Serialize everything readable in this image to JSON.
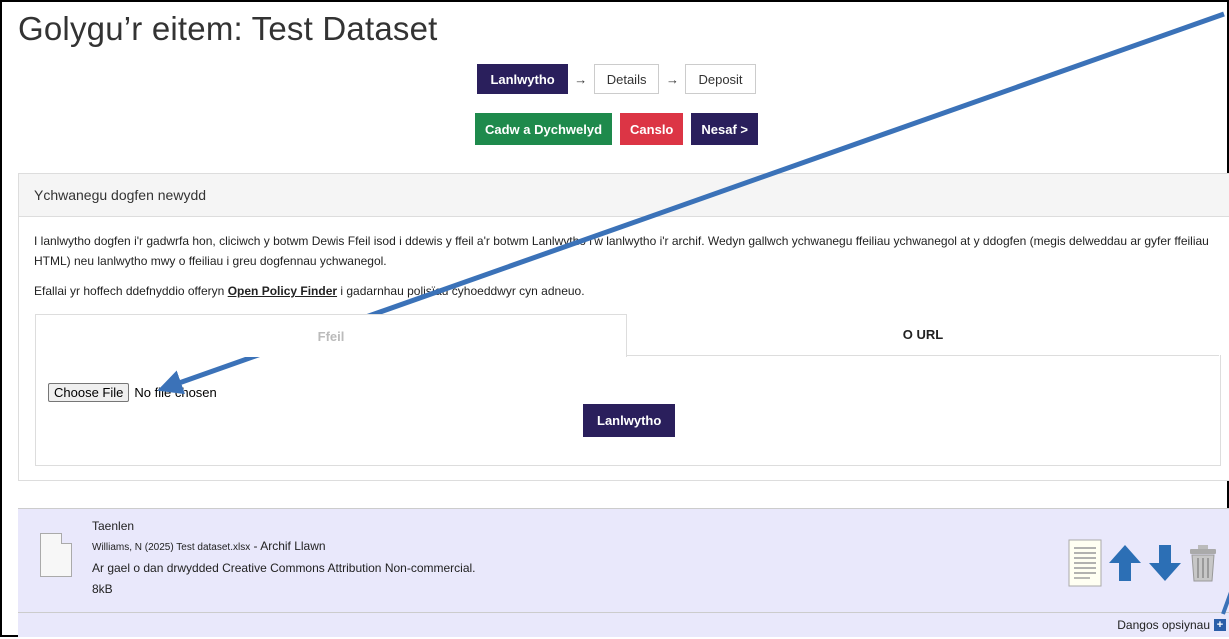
{
  "page": {
    "title": "Golygu’r eitem: Test Dataset"
  },
  "workflow": [
    {
      "label": "Lanlwytho",
      "active": true
    },
    {
      "label": "Details",
      "active": false
    },
    {
      "label": "Deposit",
      "active": false
    }
  ],
  "workflow_arrow": "→",
  "actions": {
    "save_return": "Cadw a Dychwelyd",
    "cancel": "Canslo",
    "next": "Nesaf >"
  },
  "upload_panel": {
    "heading": "Ychwanegu dogfen newydd",
    "intro": "I lanlwytho dogfen i'r gadwrfa hon, cliciwch y botwm Dewis Ffeil isod i ddewis y ffeil a'r botwm Lanlwytho i'w lanlwytho i'r archif. Wedyn gallwch ychwanegu ffeiliau ychwanegol at y ddogfen (megis delweddau ar gyfer ffeiliau HTML) neu lanlwytho mwy o ffeiliau i greu dogfennau ychwanegol.",
    "policy_before": "Efallai yr hoffech ddefnyddio offeryn ",
    "policy_link": "Open Policy Finder",
    "policy_after": " i gadarnhau polisïau cyhoeddwyr cyn adneuo.",
    "tabs": {
      "file": "Ffeil",
      "url": "O URL"
    },
    "choose_file": "Choose File",
    "no_file": "No file chosen",
    "upload_button": "Lanlwytho"
  },
  "document": {
    "type": "Taenlen",
    "citation": "Williams, N (2025) Test dataset.xlsx",
    "access": " - Archif Llawn",
    "license": "Ar gael o dan drwydded Creative Commons Attribution Non-commercial.",
    "size": "8kB",
    "tools": [
      "details-icon",
      "move-up-icon",
      "move-down-icon",
      "delete-icon"
    ],
    "show_options": "Dangos opsiynau"
  },
  "colors": {
    "navy": "#2a1f5c",
    "green": "#1e8a4c",
    "red": "#dc3545",
    "annotation_arrow": "#3b72b8",
    "document_row": "#e9e8fb"
  }
}
